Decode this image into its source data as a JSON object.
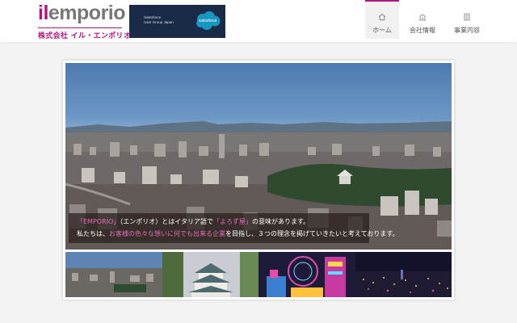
{
  "header": {
    "logo": {
      "prefix": "il",
      "name": "emporio",
      "subtitle": "株式会社 イル・エンポリオ"
    },
    "banner": {
      "text": "Salesforce\nUser Group Japan",
      "badge": "salesforce"
    },
    "nav": [
      {
        "label": "ホーム",
        "icon": "home-icon",
        "active": true
      },
      {
        "label": "会社情報",
        "icon": "building-icon",
        "active": false
      },
      {
        "label": "事業内容",
        "icon": "document-icon",
        "active": false
      }
    ]
  },
  "hero": {
    "caption": {
      "line1": [
        {
          "text": "「EMPORIO」",
          "highlight": true
        },
        {
          "text": "（エンポリオ）とはイタリア語で",
          "highlight": false
        },
        {
          "text": "「よろず屋」",
          "highlight": true
        },
        {
          "text": "の意味があります。",
          "highlight": false
        }
      ],
      "line2": [
        {
          "text": "私たちは、",
          "highlight": false
        },
        {
          "text": "お客様の色々な想いに何でも出来る企業",
          "highlight": true
        },
        {
          "text": "を目指し、３つの理念を掲げていきたいと考えております。",
          "highlight": false
        }
      ]
    }
  },
  "thumbnails": [
    {
      "name": "city-daytime-thumb"
    },
    {
      "name": "nagoya-castle-thumb"
    },
    {
      "name": "neon-ferris-wheel-thumb"
    },
    {
      "name": "city-night-thumb"
    }
  ],
  "colors": {
    "accent": "#b0157d",
    "highlight": "#e26bb3",
    "banner_bg": "#1a2b48",
    "salesforce_blue": "#1798c1"
  }
}
